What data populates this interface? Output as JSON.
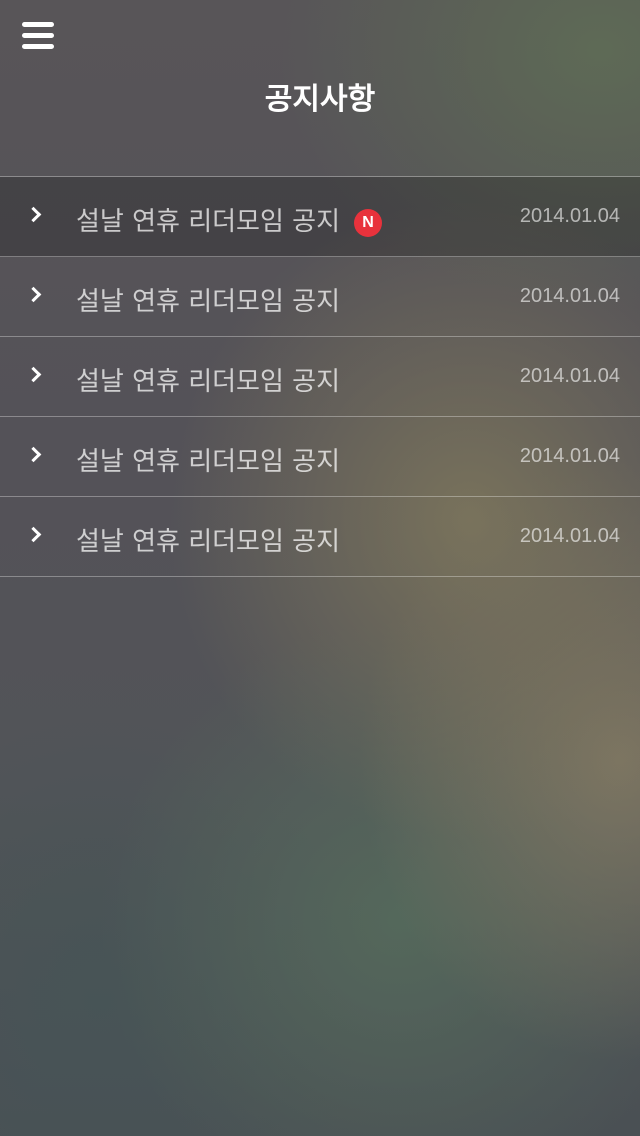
{
  "header": {
    "menu_icon": "hamburger-menu-icon",
    "title": "공지사항"
  },
  "notices": [
    {
      "title": "설날 연휴 리더모임 공지",
      "date": "2014.01.04",
      "is_new": true,
      "badge": "N"
    },
    {
      "title": "설날 연휴 리더모임 공지",
      "date": "2014.01.04",
      "is_new": false
    },
    {
      "title": "설날 연휴 리더모임 공지",
      "date": "2014.01.04",
      "is_new": false
    },
    {
      "title": "설날 연휴 리더모임 공지",
      "date": "2014.01.04",
      "is_new": false
    },
    {
      "title": "설날 연휴 리더모임 공지",
      "date": "2014.01.04",
      "is_new": false
    }
  ],
  "colors": {
    "badge": "#e8323c",
    "text": "#ffffff"
  },
  "icons": {
    "row_arrow": "chevron-right-icon"
  }
}
